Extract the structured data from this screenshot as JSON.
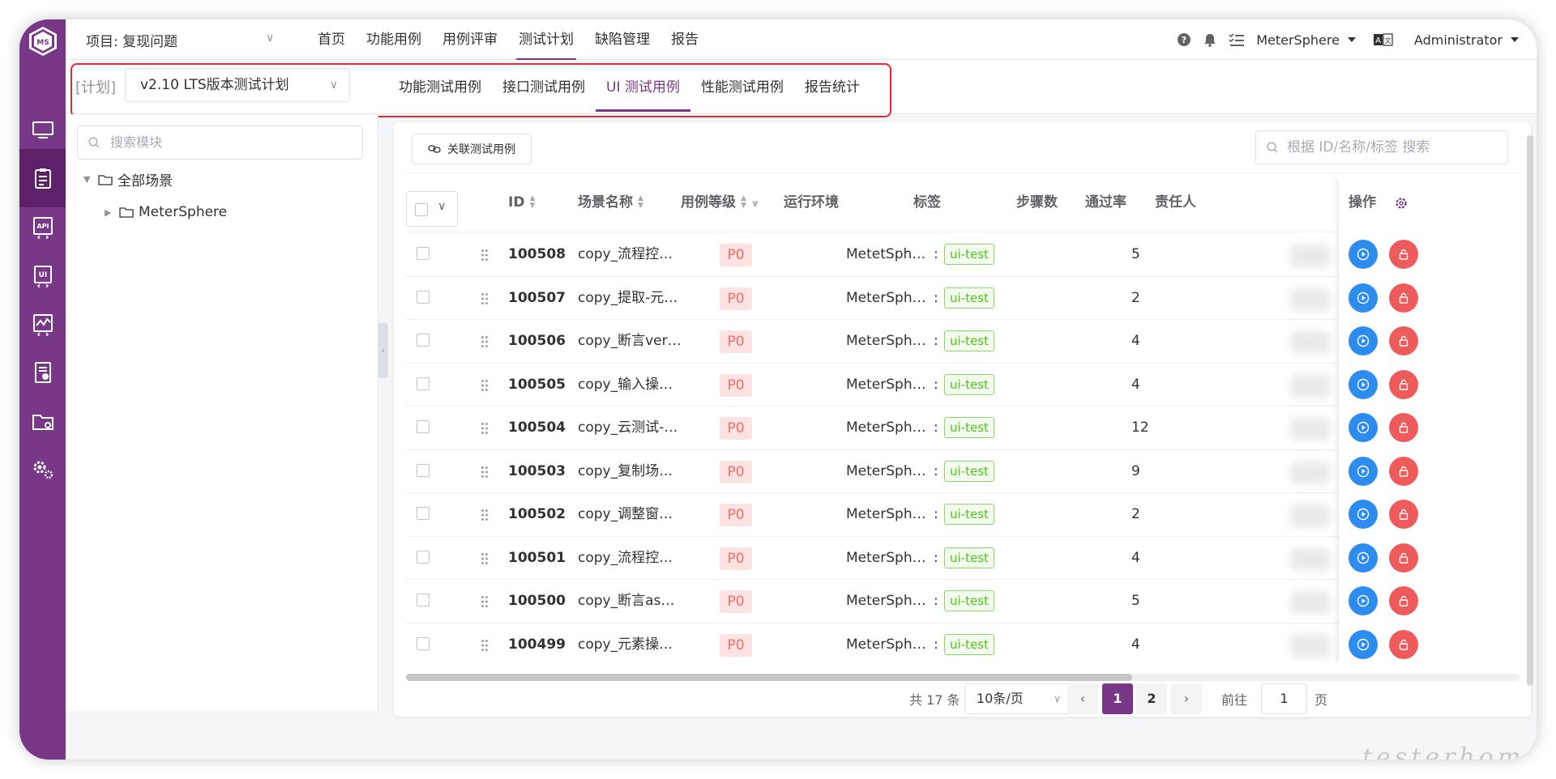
{
  "colors": {
    "brand": "#783887",
    "rail_active": "#5c2169",
    "run_button": "#2d8cf0",
    "lock_button": "#ef5a5a",
    "priority_bg": "#fde2e2",
    "priority_text": "#f56c6c",
    "tag_green": "#52c41a",
    "highlight_border": "#e8273a"
  },
  "rail": {
    "logo": "MS",
    "items": [
      {
        "icon": "monitor-icon"
      },
      {
        "icon": "clipboard-icon",
        "active": true
      },
      {
        "icon": "api-icon"
      },
      {
        "icon": "ui-icon"
      },
      {
        "icon": "performance-icon"
      },
      {
        "icon": "report-icon"
      },
      {
        "icon": "folder-settings-icon"
      },
      {
        "icon": "settings-icon"
      }
    ]
  },
  "header": {
    "project": "项目: 复现问题",
    "menu": [
      "首页",
      "功能用例",
      "用例评审",
      "测试计划",
      "缺陷管理",
      "报告"
    ],
    "active_menu": "测试计划",
    "workspace": "MeterSphere",
    "user": "Administrator"
  },
  "subheader": {
    "plan_label": "[计划]",
    "plan_value": "v2.10 LTS版本测试计划",
    "tabs": [
      "功能测试用例",
      "接口测试用例",
      "UI 测试用例",
      "性能测试用例",
      "报告统计"
    ],
    "active_tab": "UI 测试用例"
  },
  "tree": {
    "search_placeholder": "搜索模块",
    "root": "全部场景",
    "child": "MeterSphere"
  },
  "toolbar": {
    "associate_button": "关联测试用例",
    "search_placeholder": "根据 ID/名称/标签 搜索"
  },
  "table": {
    "columns": {
      "id": "ID",
      "name": "场景名称",
      "level": "用例等级",
      "env": "运行环境",
      "tags": "标签",
      "steps": "步骤数",
      "pass_rate": "通过率",
      "owner": "责任人",
      "ops": "操作"
    },
    "rows": [
      {
        "id": "100508",
        "name": "copy_流程控…",
        "level": "P0",
        "env": "MetetSph…",
        "tag": "ui-test",
        "steps": "5"
      },
      {
        "id": "100507",
        "name": "copy_提取-元…",
        "level": "P0",
        "env": "MeterSph…",
        "tag": "ui-test",
        "steps": "2"
      },
      {
        "id": "100506",
        "name": "copy_断言ver…",
        "level": "P0",
        "env": "MeterSph…",
        "tag": "ui-test",
        "steps": "4"
      },
      {
        "id": "100505",
        "name": "copy_输入操…",
        "level": "P0",
        "env": "MeterSph…",
        "tag": "ui-test",
        "steps": "4"
      },
      {
        "id": "100504",
        "name": "copy_云测试-…",
        "level": "P0",
        "env": "MeterSph…",
        "tag": "ui-test",
        "steps": "12"
      },
      {
        "id": "100503",
        "name": "copy_复制场…",
        "level": "P0",
        "env": "MeterSph…",
        "tag": "ui-test",
        "steps": "9"
      },
      {
        "id": "100502",
        "name": "copy_调整窗…",
        "level": "P0",
        "env": "MeterSph…",
        "tag": "ui-test",
        "steps": "2"
      },
      {
        "id": "100501",
        "name": "copy_流程控…",
        "level": "P0",
        "env": "MeterSph…",
        "tag": "ui-test",
        "steps": "4"
      },
      {
        "id": "100500",
        "name": "copy_断言as…",
        "level": "P0",
        "env": "MeterSph…",
        "tag": "ui-test",
        "steps": "5"
      },
      {
        "id": "100499",
        "name": "copy_元素操…",
        "level": "P0",
        "env": "MeterSph…",
        "tag": "ui-test",
        "steps": "4"
      }
    ]
  },
  "pagination": {
    "total": "共 17 条",
    "page_size": "10条/页",
    "pages": [
      "1",
      "2"
    ],
    "current": "1",
    "goto_label": "前往",
    "goto_value": "1",
    "page_unit": "页"
  },
  "watermark": "testerhome.com"
}
